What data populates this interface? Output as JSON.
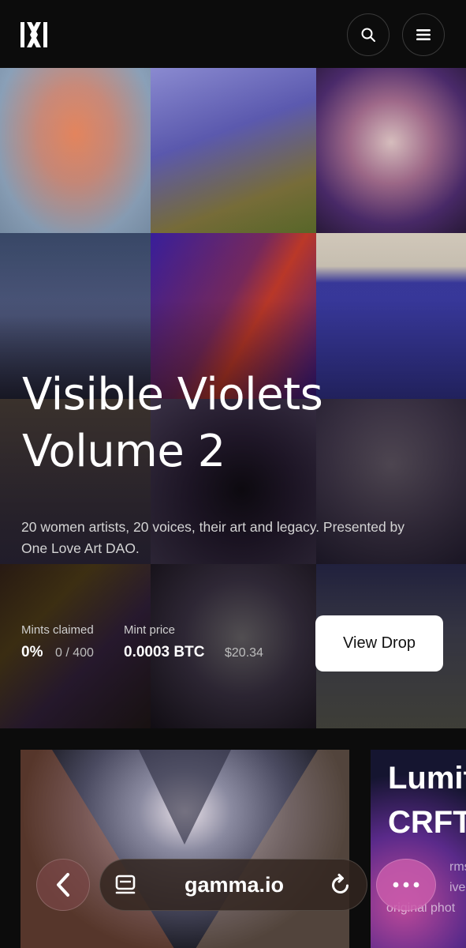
{
  "header": {
    "logo_icon": "gamma-logo-icon",
    "search_icon": "search-icon",
    "menu_icon": "menu-icon"
  },
  "hero": {
    "title_line1": "Visible Violets",
    "title_line2": "Volume 2",
    "subtitle": "20 women artists, 20 voices, their art and legacy. Presented by One Love Art DAO.",
    "mints_label": "Mints claimed",
    "mints_percent": "0%",
    "mints_count": "0 / 400",
    "price_label": "Mint price",
    "price_btc": "0.0003 BTC",
    "price_usd": "$20.34",
    "cta_label": "View Drop"
  },
  "cards": {
    "second_title_line1": "Lumif",
    "second_title_line2": "CRFT",
    "second_sub_line1": "rms b",
    "second_sub_line2": "ive c",
    "second_sub_line3": "original phot"
  },
  "browser": {
    "url": "gamma.io",
    "back_icon": "chevron-left-icon",
    "tabs_icon": "tabs-icon",
    "reload_icon": "reload-icon",
    "more_icon": "more-icon"
  },
  "colors": {
    "background": "#0c0c0c",
    "accent_violet": "#5a3ca0",
    "more_button": "#c85aaa"
  }
}
